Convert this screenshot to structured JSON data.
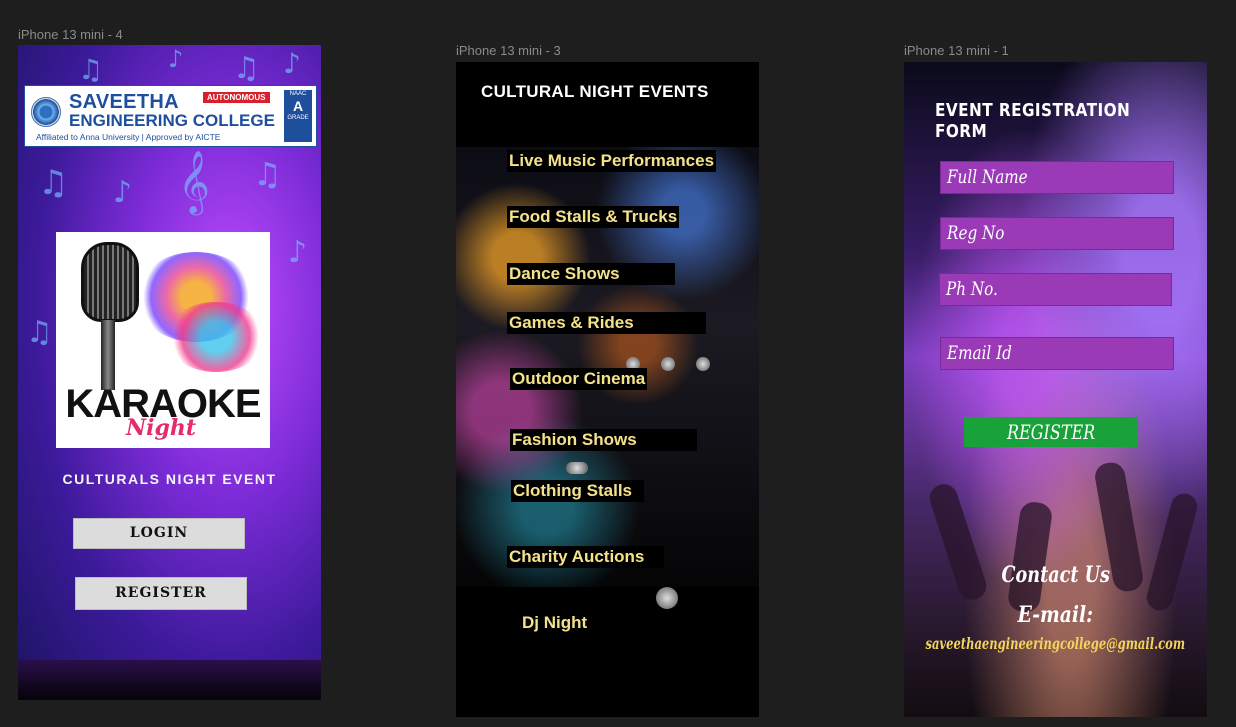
{
  "canvas": {
    "frames": [
      {
        "label": "iPhone 13 mini - 4"
      },
      {
        "label": "iPhone 13 mini - 3"
      },
      {
        "label": "iPhone 13 mini - 1"
      }
    ]
  },
  "home_screen": {
    "college": {
      "name_line1": "SAVEETHA",
      "name_line2": "ENGINEERING COLLEGE",
      "badge": "AUTONOMOUS",
      "affiliation": "Affiliated to Anna University | Approved by AICTE",
      "accreditation_top": "NAAC",
      "accreditation_grade": "A",
      "accreditation_bottom": "GRADE"
    },
    "poster": {
      "headline": "KARAOKE",
      "script": "Night"
    },
    "subtitle": "CULTURALS  NIGHT EVENT",
    "login_label": "LOGIN",
    "register_label": "REGISTER"
  },
  "events_screen": {
    "title": "CULTURAL NIGHT EVENTS",
    "events": [
      "Live Music Performances",
      "Food Stalls & Trucks",
      "Dance Shows",
      "Games & Rides",
      "Outdoor  Cinema",
      "Fashion Shows",
      "Clothing Stalls",
      "Charity Auctions",
      "Dj Night"
    ]
  },
  "registration_screen": {
    "title": "EVENT  REGISTRATION FORM",
    "fields": {
      "full_name": "Full Name",
      "reg_no": "Reg No",
      "ph_no": "Ph No.",
      "email_id": "Email Id"
    },
    "register_label": "REGISTER",
    "contact_title": "Contact Us",
    "email_label": "E-mail:",
    "email_value": "saveethaengineeringcollege@gmail.com"
  },
  "colors": {
    "canvas_bg": "#1e1e1e",
    "event_text": "#f4e28a",
    "form_field": "#9a3ab7",
    "register_green": "#19a13a",
    "email_yellow": "#f3d45c"
  }
}
